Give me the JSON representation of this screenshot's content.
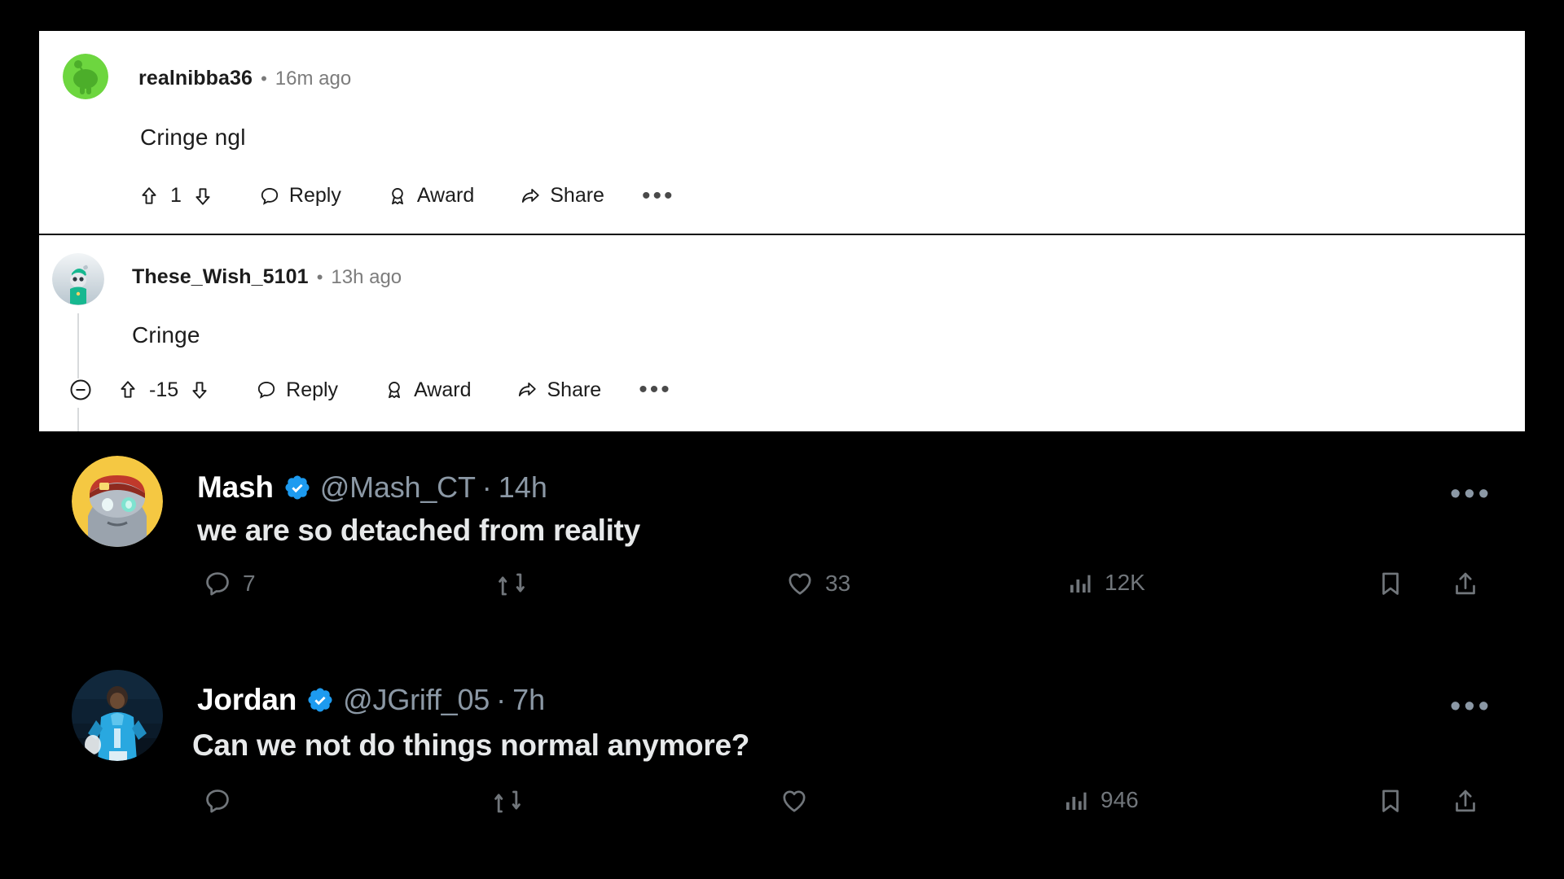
{
  "reddit": {
    "comments": [
      {
        "username": "realnibba36",
        "separator": "•",
        "timestamp": "16m ago",
        "body": "Cringe ngl",
        "score": "1",
        "reply_label": "Reply",
        "award_label": "Award",
        "share_label": "Share",
        "more_label": "•••",
        "avatar_type": "snoo-green",
        "collapsed_toggle": false
      },
      {
        "username": "These_Wish_5101",
        "separator": "•",
        "timestamp": "13h ago",
        "body": "Cringe",
        "score": "-15",
        "reply_label": "Reply",
        "award_label": "Award",
        "share_label": "Share",
        "more_label": "•••",
        "avatar_type": "snoo-teal-hat",
        "collapsed_toggle": true
      }
    ]
  },
  "twitter": {
    "tweets": [
      {
        "display_name": "Mash",
        "verified": true,
        "handle": "@Mash_CT",
        "separator": "·",
        "timestamp": "14h",
        "text": "we are so detached from reality",
        "reply_count": "7",
        "retweet_count": "",
        "like_count": "33",
        "views_count": "12K",
        "more_label": "•••",
        "avatar_type": "robot-red-cap"
      },
      {
        "display_name": "Jordan",
        "verified": true,
        "handle": "@JGriff_05",
        "separator": "·",
        "timestamp": "7h",
        "text": "Can we not do things normal anymore?",
        "reply_count": "",
        "retweet_count": "",
        "like_count": "",
        "views_count": "946",
        "more_label": "•••",
        "avatar_type": "athlete-blue-jersey"
      }
    ]
  },
  "colors": {
    "reddit_bg": "#ffffff",
    "reddit_text": "#1c1c1c",
    "reddit_meta": "#7c7c7c",
    "snoo_green": "#6dd63f",
    "twitter_bg": "#000000",
    "twitter_text": "#e7e9ea",
    "twitter_meta": "#71767b",
    "verified_blue": "#1d9bf0",
    "page_bg": "#000000"
  }
}
